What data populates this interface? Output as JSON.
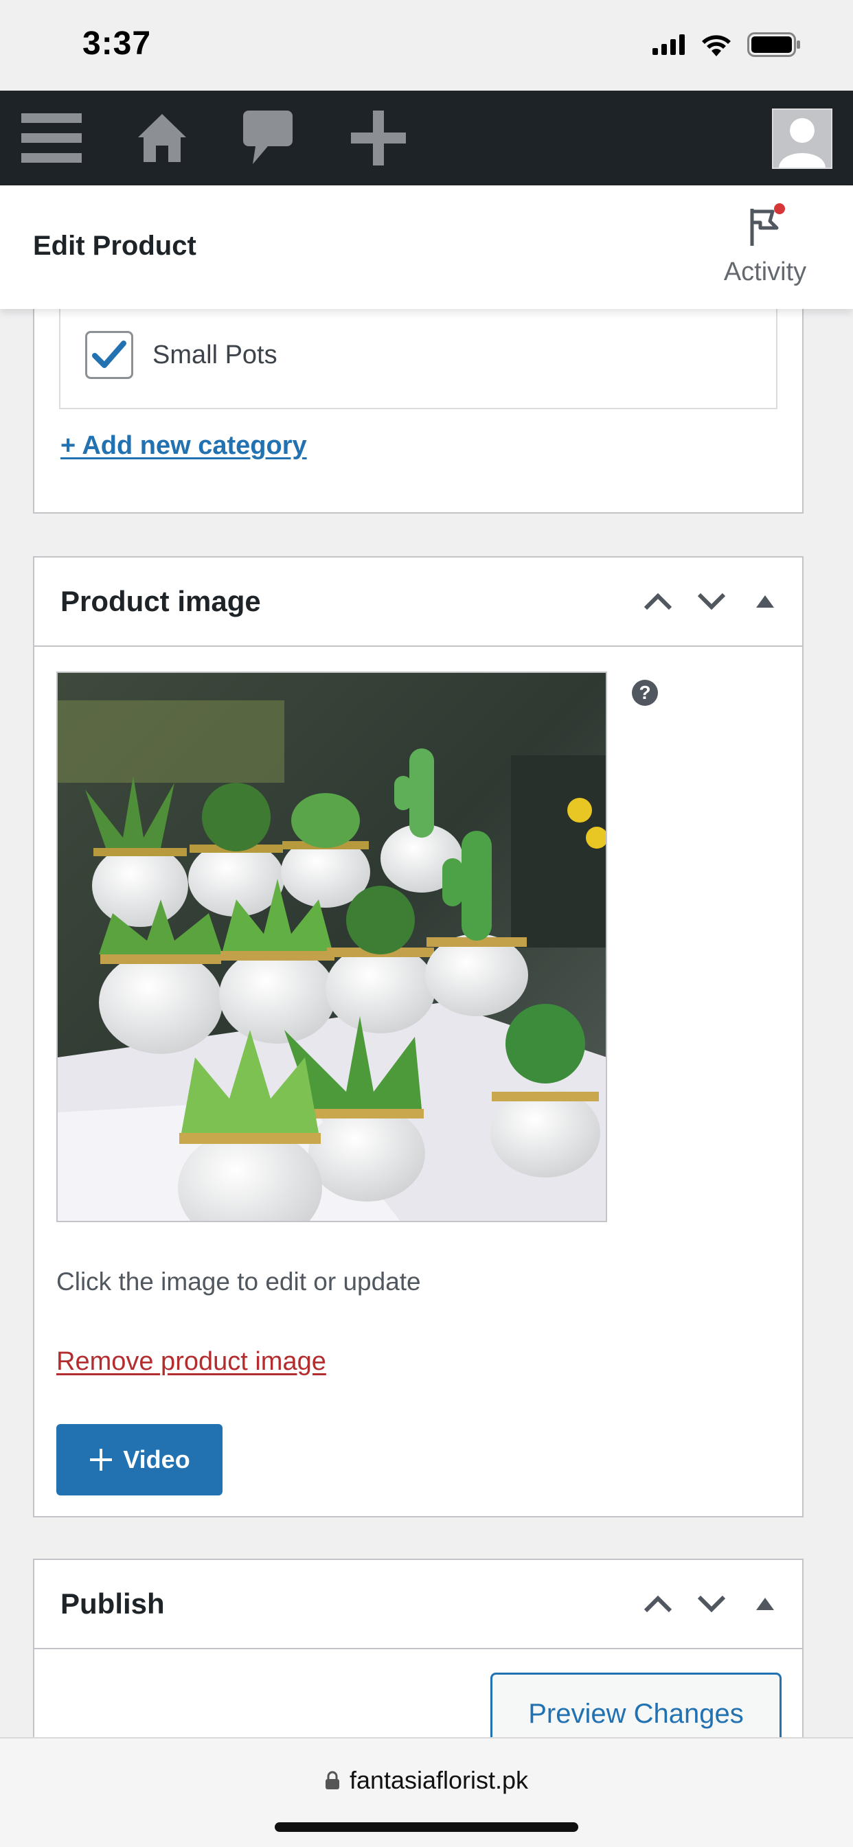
{
  "status_bar": {
    "time": "3:37",
    "icons": [
      "signal-icon",
      "wifi-icon",
      "battery-icon"
    ]
  },
  "admin_bar": {
    "icons": [
      "menu-icon",
      "home-icon",
      "comment-icon",
      "plus-icon",
      "avatar-icon"
    ]
  },
  "header": {
    "title": "Edit Product",
    "activity_label": "Activity"
  },
  "categories": {
    "items": [
      {
        "label": "Small Pots",
        "checked": true
      }
    ],
    "add_link": "+ Add new category"
  },
  "product_image": {
    "title": "Product image",
    "help_label": "?",
    "hint": "Click the image to edit or update",
    "remove_link": "Remove product image",
    "video_button": "Video"
  },
  "publish": {
    "title": "Publish",
    "preview_button": "Preview Changes"
  },
  "url_bar": {
    "domain": "fantasiaflorist.pk"
  },
  "colors": {
    "admin_bar": "#1d2327",
    "accent": "#2271b1",
    "danger": "#b32d2e",
    "notification": "#d63638"
  }
}
